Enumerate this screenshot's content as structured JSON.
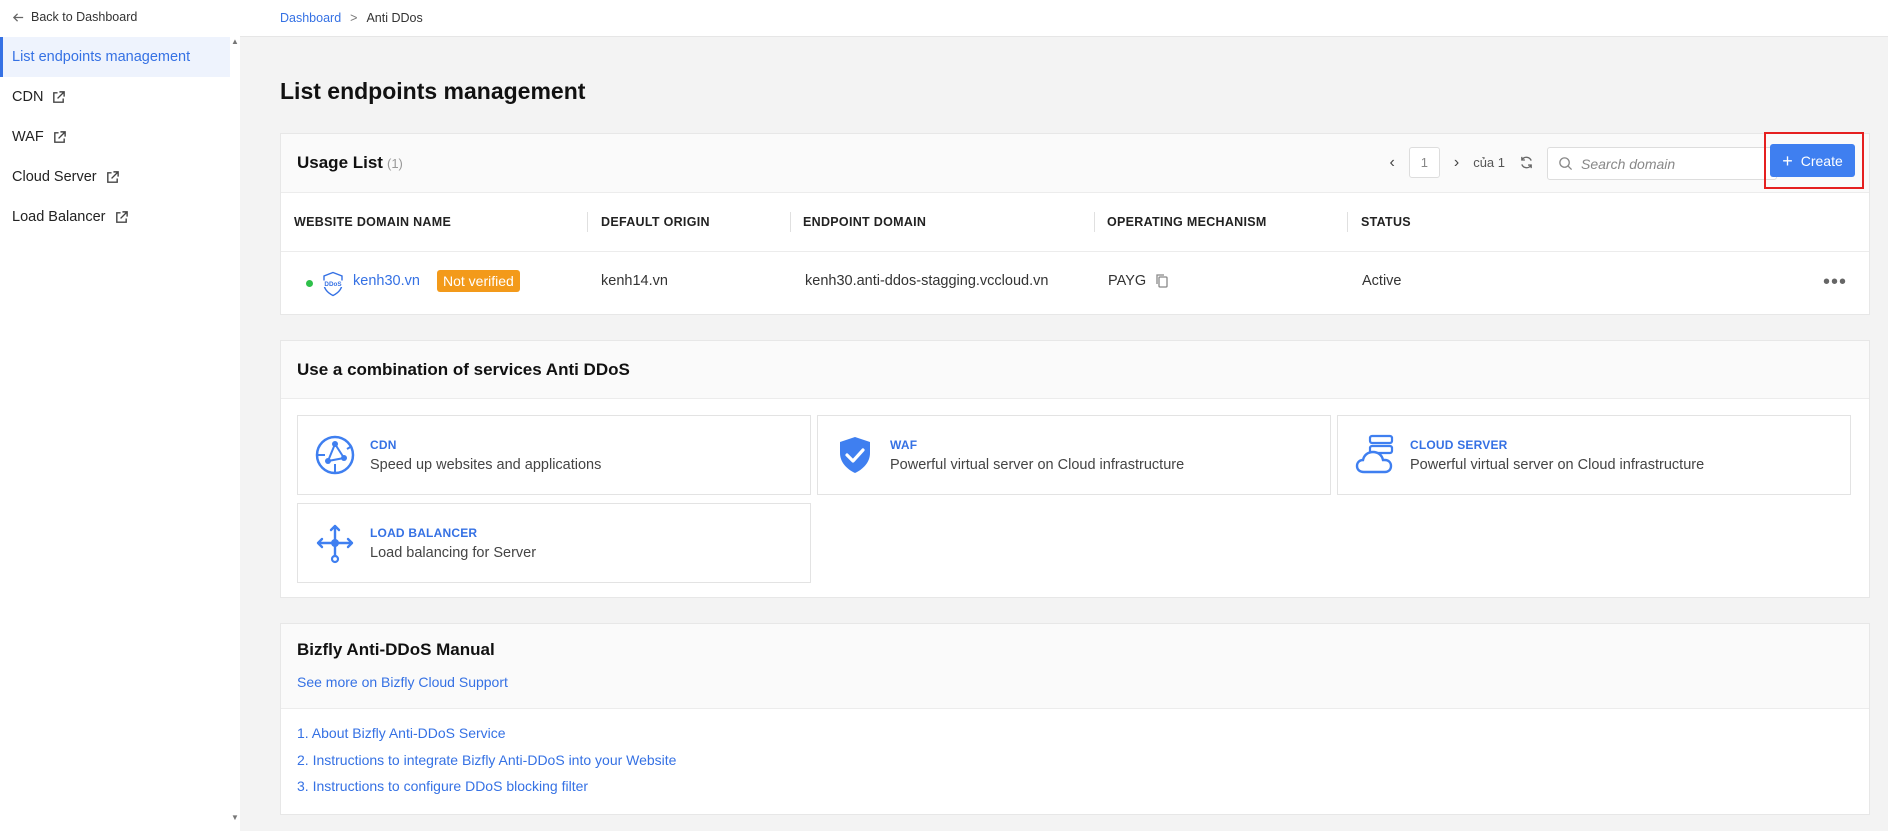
{
  "sidebar": {
    "back_label": "Back to Dashboard",
    "items": [
      {
        "label": "List endpoints management"
      },
      {
        "label": "CDN"
      },
      {
        "label": "WAF"
      },
      {
        "label": "Cloud Server"
      },
      {
        "label": "Load Balancer"
      }
    ]
  },
  "breadcrumb": {
    "root": "Dashboard",
    "sep": ">",
    "current": "Anti DDos"
  },
  "page": {
    "title": "List endpoints management"
  },
  "usage": {
    "title": "Usage List",
    "count": "(1)",
    "pager": {
      "page": "1",
      "of_label": "của 1"
    },
    "search_placeholder": "Search domain",
    "create_label": "Create",
    "columns": [
      "WEBSITE DOMAIN NAME",
      "DEFAULT ORIGIN",
      "ENDPOINT DOMAIN",
      "OPERATING MECHANISM",
      "STATUS"
    ],
    "rows": [
      {
        "domain": "kenh30.vn",
        "badge": "Not verified",
        "origin": "kenh14.vn",
        "endpoint": "kenh30.anti-ddos-stagging.vccloud.vn",
        "mechanism": "PAYG",
        "status": "Active",
        "more": "•••"
      }
    ]
  },
  "services": {
    "title": "Use a combination of services Anti DDoS",
    "items": [
      {
        "name": "CDN",
        "desc": "Speed up websites and applications",
        "icon": "cdn-icon"
      },
      {
        "name": "WAF",
        "desc": "Powerful virtual server on Cloud infrastructure",
        "icon": "shield-check-icon"
      },
      {
        "name": "CLOUD SERVER",
        "desc": "Powerful virtual server on Cloud infrastructure",
        "icon": "cloud-server-icon"
      },
      {
        "name": "LOAD BALANCER",
        "desc": "Load balancing for Server",
        "icon": "load-balancer-icon"
      }
    ]
  },
  "manual": {
    "title": "Bizfly Anti-DDoS Manual",
    "subtitle": "See more on Bizfly Cloud Support",
    "links": [
      "1. About Bizfly Anti-DDoS Service",
      "2. Instructions to integrate Bizfly Anti-DDoS into your Website",
      "3. Instructions to configure DDoS blocking filter"
    ]
  },
  "colors": {
    "accent": "#3571e4",
    "button": "#3f7ff0",
    "badge": "#f39a1a",
    "status_dot": "#2ec04a",
    "highlight_box": "#e52020"
  }
}
